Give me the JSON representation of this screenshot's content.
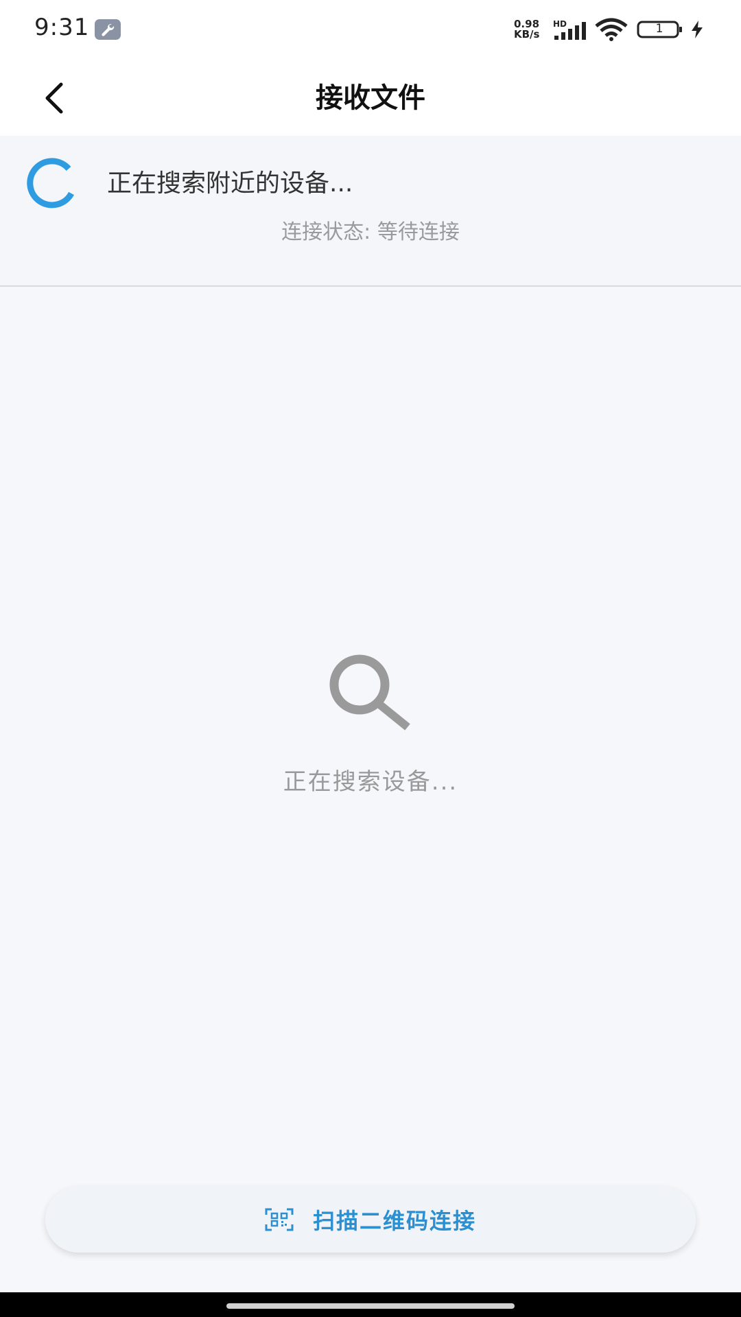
{
  "status_bar": {
    "time": "9:31",
    "net_speed_value": "0.98",
    "net_speed_unit": "KB/s",
    "hd_label": "HD",
    "battery_level": "1"
  },
  "header": {
    "title": "接收文件",
    "back_icon": "chevron-left-icon"
  },
  "search_panel": {
    "searching_text": "正在搜索附近的设备...",
    "connection_status": "连接状态: 等待连接",
    "spinner_color": "#2f9be0"
  },
  "empty_state": {
    "icon": "search-icon",
    "text": "正在搜索设备..."
  },
  "actions": {
    "scan_qr_label": "扫描二维码连接",
    "scan_qr_icon": "qr-code-icon",
    "accent_color": "#2b8fd0"
  }
}
